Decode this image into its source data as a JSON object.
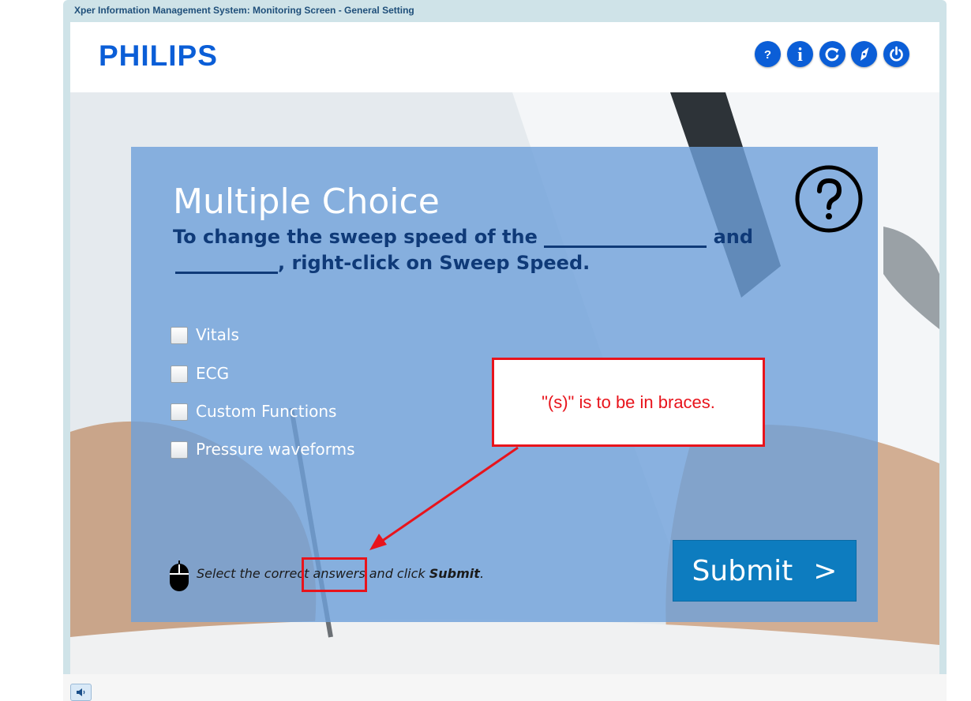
{
  "window": {
    "title": "Xper Information Management System: Monitoring Screen - General Setting"
  },
  "header": {
    "logo": "PHILIPS",
    "buttons": [
      {
        "name": "help",
        "glyph": "?"
      },
      {
        "name": "info",
        "glyph": "i"
      },
      {
        "name": "refresh",
        "glyph": "↻"
      },
      {
        "name": "navigate",
        "glyph": "compass"
      },
      {
        "name": "power",
        "glyph": "⏻"
      }
    ]
  },
  "quiz": {
    "title": "Multiple Choice",
    "question_part1": "To change the sweep speed of the",
    "question_part2": "and",
    "question_part3": ", right-click on Sweep Speed.",
    "options": [
      {
        "label": "Vitals",
        "checked": false
      },
      {
        "label": "ECG",
        "checked": false
      },
      {
        "label": "Custom Functions",
        "checked": false
      },
      {
        "label": "Pressure waveforms",
        "checked": false
      }
    ],
    "instruction_prefix": "Select the correct answers and click ",
    "instruction_bold": "Submit",
    "instruction_suffix": ".",
    "submit_label": "Submit",
    "submit_arrow": ">"
  },
  "annotation": {
    "callout_text": "\"(s)\" is to be in braces.",
    "color": "#e8141c"
  },
  "colors": {
    "accent_blue": "#0b5ed7",
    "panel_blue": "#6ea0da",
    "submit_blue": "#0d7cbf",
    "question_text": "#0f3a78"
  }
}
